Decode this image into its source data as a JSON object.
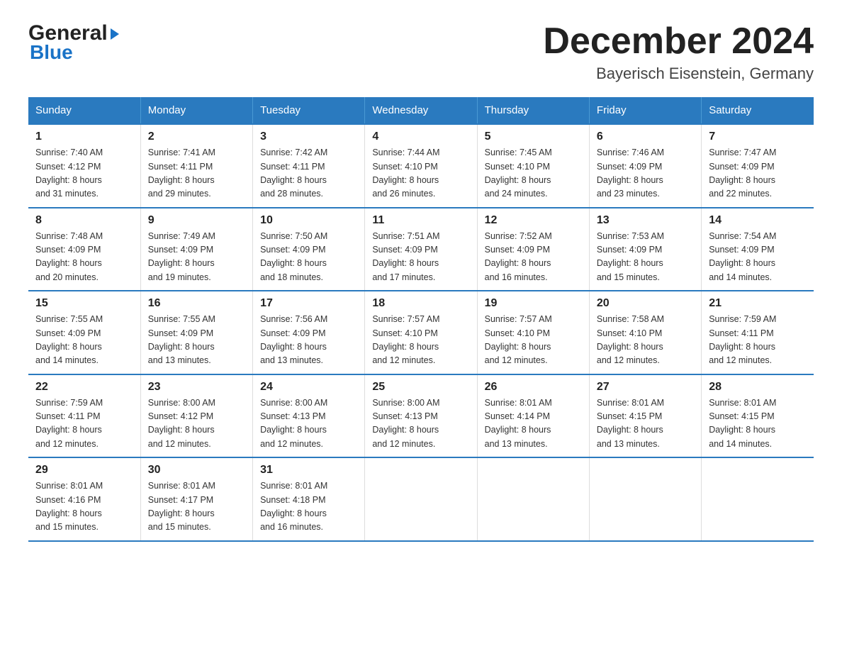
{
  "header": {
    "logo_line1": "General",
    "logo_line2": "Blue",
    "month_title": "December 2024",
    "location": "Bayerisch Eisenstein, Germany"
  },
  "columns": [
    "Sunday",
    "Monday",
    "Tuesday",
    "Wednesday",
    "Thursday",
    "Friday",
    "Saturday"
  ],
  "weeks": [
    [
      {
        "day": "1",
        "sunrise": "Sunrise: 7:40 AM",
        "sunset": "Sunset: 4:12 PM",
        "daylight": "Daylight: 8 hours",
        "daylight2": "and 31 minutes."
      },
      {
        "day": "2",
        "sunrise": "Sunrise: 7:41 AM",
        "sunset": "Sunset: 4:11 PM",
        "daylight": "Daylight: 8 hours",
        "daylight2": "and 29 minutes."
      },
      {
        "day": "3",
        "sunrise": "Sunrise: 7:42 AM",
        "sunset": "Sunset: 4:11 PM",
        "daylight": "Daylight: 8 hours",
        "daylight2": "and 28 minutes."
      },
      {
        "day": "4",
        "sunrise": "Sunrise: 7:44 AM",
        "sunset": "Sunset: 4:10 PM",
        "daylight": "Daylight: 8 hours",
        "daylight2": "and 26 minutes."
      },
      {
        "day": "5",
        "sunrise": "Sunrise: 7:45 AM",
        "sunset": "Sunset: 4:10 PM",
        "daylight": "Daylight: 8 hours",
        "daylight2": "and 24 minutes."
      },
      {
        "day": "6",
        "sunrise": "Sunrise: 7:46 AM",
        "sunset": "Sunset: 4:09 PM",
        "daylight": "Daylight: 8 hours",
        "daylight2": "and 23 minutes."
      },
      {
        "day": "7",
        "sunrise": "Sunrise: 7:47 AM",
        "sunset": "Sunset: 4:09 PM",
        "daylight": "Daylight: 8 hours",
        "daylight2": "and 22 minutes."
      }
    ],
    [
      {
        "day": "8",
        "sunrise": "Sunrise: 7:48 AM",
        "sunset": "Sunset: 4:09 PM",
        "daylight": "Daylight: 8 hours",
        "daylight2": "and 20 minutes."
      },
      {
        "day": "9",
        "sunrise": "Sunrise: 7:49 AM",
        "sunset": "Sunset: 4:09 PM",
        "daylight": "Daylight: 8 hours",
        "daylight2": "and 19 minutes."
      },
      {
        "day": "10",
        "sunrise": "Sunrise: 7:50 AM",
        "sunset": "Sunset: 4:09 PM",
        "daylight": "Daylight: 8 hours",
        "daylight2": "and 18 minutes."
      },
      {
        "day": "11",
        "sunrise": "Sunrise: 7:51 AM",
        "sunset": "Sunset: 4:09 PM",
        "daylight": "Daylight: 8 hours",
        "daylight2": "and 17 minutes."
      },
      {
        "day": "12",
        "sunrise": "Sunrise: 7:52 AM",
        "sunset": "Sunset: 4:09 PM",
        "daylight": "Daylight: 8 hours",
        "daylight2": "and 16 minutes."
      },
      {
        "day": "13",
        "sunrise": "Sunrise: 7:53 AM",
        "sunset": "Sunset: 4:09 PM",
        "daylight": "Daylight: 8 hours",
        "daylight2": "and 15 minutes."
      },
      {
        "day": "14",
        "sunrise": "Sunrise: 7:54 AM",
        "sunset": "Sunset: 4:09 PM",
        "daylight": "Daylight: 8 hours",
        "daylight2": "and 14 minutes."
      }
    ],
    [
      {
        "day": "15",
        "sunrise": "Sunrise: 7:55 AM",
        "sunset": "Sunset: 4:09 PM",
        "daylight": "Daylight: 8 hours",
        "daylight2": "and 14 minutes."
      },
      {
        "day": "16",
        "sunrise": "Sunrise: 7:55 AM",
        "sunset": "Sunset: 4:09 PM",
        "daylight": "Daylight: 8 hours",
        "daylight2": "and 13 minutes."
      },
      {
        "day": "17",
        "sunrise": "Sunrise: 7:56 AM",
        "sunset": "Sunset: 4:09 PM",
        "daylight": "Daylight: 8 hours",
        "daylight2": "and 13 minutes."
      },
      {
        "day": "18",
        "sunrise": "Sunrise: 7:57 AM",
        "sunset": "Sunset: 4:10 PM",
        "daylight": "Daylight: 8 hours",
        "daylight2": "and 12 minutes."
      },
      {
        "day": "19",
        "sunrise": "Sunrise: 7:57 AM",
        "sunset": "Sunset: 4:10 PM",
        "daylight": "Daylight: 8 hours",
        "daylight2": "and 12 minutes."
      },
      {
        "day": "20",
        "sunrise": "Sunrise: 7:58 AM",
        "sunset": "Sunset: 4:10 PM",
        "daylight": "Daylight: 8 hours",
        "daylight2": "and 12 minutes."
      },
      {
        "day": "21",
        "sunrise": "Sunrise: 7:59 AM",
        "sunset": "Sunset: 4:11 PM",
        "daylight": "Daylight: 8 hours",
        "daylight2": "and 12 minutes."
      }
    ],
    [
      {
        "day": "22",
        "sunrise": "Sunrise: 7:59 AM",
        "sunset": "Sunset: 4:11 PM",
        "daylight": "Daylight: 8 hours",
        "daylight2": "and 12 minutes."
      },
      {
        "day": "23",
        "sunrise": "Sunrise: 8:00 AM",
        "sunset": "Sunset: 4:12 PM",
        "daylight": "Daylight: 8 hours",
        "daylight2": "and 12 minutes."
      },
      {
        "day": "24",
        "sunrise": "Sunrise: 8:00 AM",
        "sunset": "Sunset: 4:13 PM",
        "daylight": "Daylight: 8 hours",
        "daylight2": "and 12 minutes."
      },
      {
        "day": "25",
        "sunrise": "Sunrise: 8:00 AM",
        "sunset": "Sunset: 4:13 PM",
        "daylight": "Daylight: 8 hours",
        "daylight2": "and 12 minutes."
      },
      {
        "day": "26",
        "sunrise": "Sunrise: 8:01 AM",
        "sunset": "Sunset: 4:14 PM",
        "daylight": "Daylight: 8 hours",
        "daylight2": "and 13 minutes."
      },
      {
        "day": "27",
        "sunrise": "Sunrise: 8:01 AM",
        "sunset": "Sunset: 4:15 PM",
        "daylight": "Daylight: 8 hours",
        "daylight2": "and 13 minutes."
      },
      {
        "day": "28",
        "sunrise": "Sunrise: 8:01 AM",
        "sunset": "Sunset: 4:15 PM",
        "daylight": "Daylight: 8 hours",
        "daylight2": "and 14 minutes."
      }
    ],
    [
      {
        "day": "29",
        "sunrise": "Sunrise: 8:01 AM",
        "sunset": "Sunset: 4:16 PM",
        "daylight": "Daylight: 8 hours",
        "daylight2": "and 15 minutes."
      },
      {
        "day": "30",
        "sunrise": "Sunrise: 8:01 AM",
        "sunset": "Sunset: 4:17 PM",
        "daylight": "Daylight: 8 hours",
        "daylight2": "and 15 minutes."
      },
      {
        "day": "31",
        "sunrise": "Sunrise: 8:01 AM",
        "sunset": "Sunset: 4:18 PM",
        "daylight": "Daylight: 8 hours",
        "daylight2": "and 16 minutes."
      },
      {
        "day": "",
        "sunrise": "",
        "sunset": "",
        "daylight": "",
        "daylight2": ""
      },
      {
        "day": "",
        "sunrise": "",
        "sunset": "",
        "daylight": "",
        "daylight2": ""
      },
      {
        "day": "",
        "sunrise": "",
        "sunset": "",
        "daylight": "",
        "daylight2": ""
      },
      {
        "day": "",
        "sunrise": "",
        "sunset": "",
        "daylight": "",
        "daylight2": ""
      }
    ]
  ]
}
